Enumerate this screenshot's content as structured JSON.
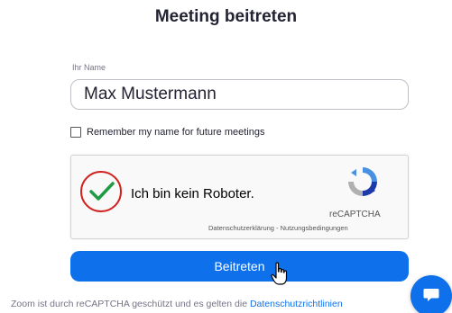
{
  "page": {
    "title": "Meeting beitreten"
  },
  "name_field": {
    "label": "Ihr Name",
    "value": "Max Mustermann"
  },
  "remember": {
    "label": "Remember my name for future meetings",
    "checked": false
  },
  "captcha": {
    "label": "Ich bin kein Roboter.",
    "brand": "reCAPTCHA",
    "links": "Datenschutzerklärung - Nutzungsbedingungen",
    "checked": true,
    "check_color": "#1f9a45",
    "highlight_color": "#d0231f"
  },
  "join_button": {
    "label": "Beitreten",
    "color": "#0e71eb"
  },
  "footer": {
    "text": "Zoom ist durch reCAPTCHA geschützt und es gelten die ",
    "link": "Datenschutzrichtlinien"
  },
  "icons": {
    "cursor": "hand-pointer-icon",
    "chat": "chat-bubble-icon",
    "captcha_logo": "recaptcha-logo-icon",
    "checkmark": "checkmark-icon"
  }
}
